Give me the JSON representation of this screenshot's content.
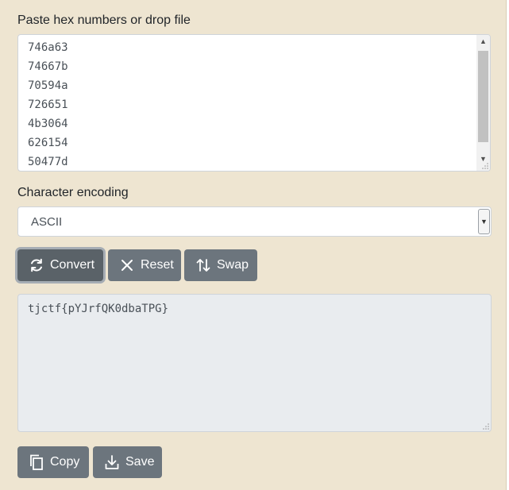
{
  "input": {
    "label": "Paste hex numbers or drop file",
    "lines": [
      "746a63",
      "74667b",
      "70594a",
      "726651",
      "4b3064",
      "626154",
      "50477d"
    ]
  },
  "encoding": {
    "label": "Character encoding",
    "selected": "ASCII"
  },
  "actions": {
    "convert_label": "Convert",
    "reset_label": "Reset",
    "swap_label": "Swap"
  },
  "output": {
    "text": "tjctf{pYJrfQK0dbaTPG}"
  },
  "footer_actions": {
    "copy_label": "Copy",
    "save_label": "Save"
  },
  "colors": {
    "panel_background": "#eee5d1",
    "button": "#6c757d",
    "output_background": "#e9ecef"
  }
}
